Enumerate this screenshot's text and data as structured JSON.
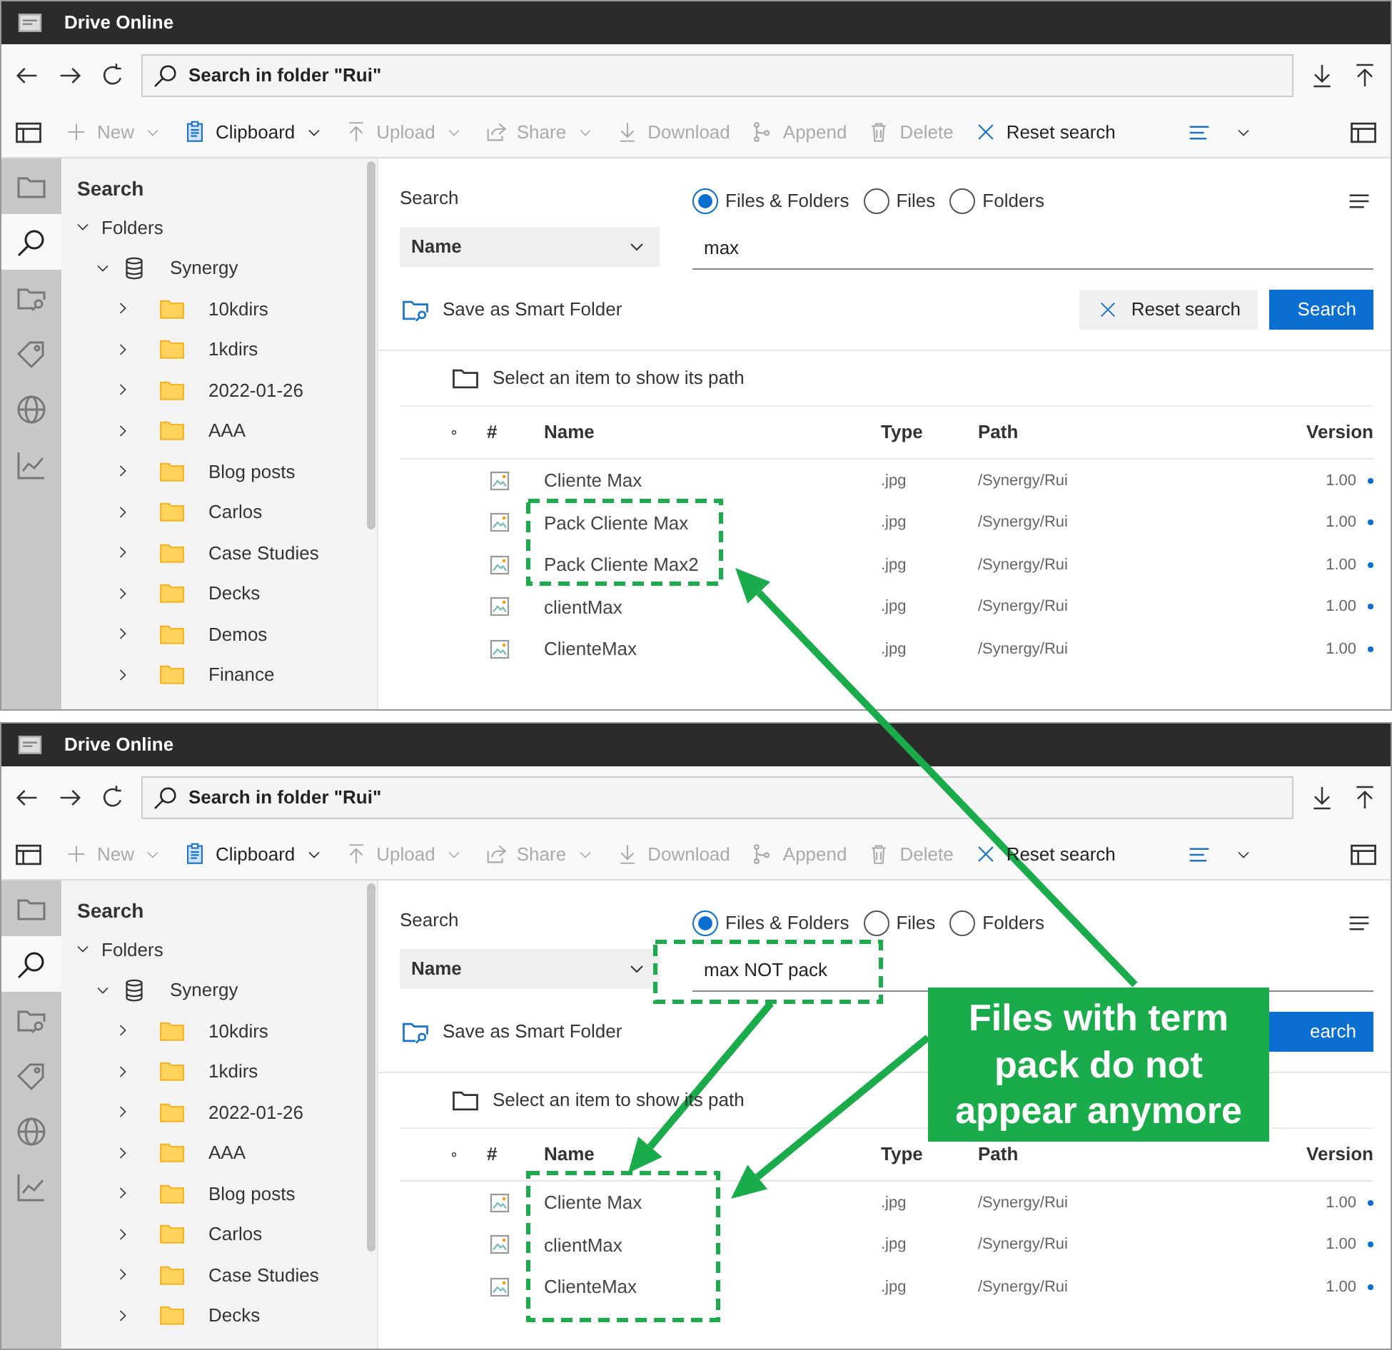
{
  "panels": [
    {
      "window": {
        "title": "Drive Online"
      },
      "address": {
        "text": "Search in folder \"Rui\""
      },
      "toolbar": [
        {
          "kind": "new",
          "label": "New",
          "disabled": true,
          "menu": true
        },
        {
          "kind": "clipboard",
          "label": "Clipboard",
          "disabled": false,
          "menu": true
        },
        {
          "kind": "upload",
          "label": "Upload",
          "disabled": true,
          "menu": true
        },
        {
          "kind": "share",
          "label": "Share",
          "disabled": true,
          "menu": true
        },
        {
          "kind": "download",
          "label": "Download",
          "disabled": true,
          "menu": false
        },
        {
          "kind": "append",
          "label": "Append",
          "disabled": true,
          "menu": false
        },
        {
          "kind": "delete",
          "label": "Delete",
          "disabled": true,
          "menu": false
        },
        {
          "kind": "reset",
          "label": "Reset search",
          "disabled": false,
          "menu": false
        }
      ],
      "rail": [
        {
          "kind": "folder",
          "selected": false
        },
        {
          "kind": "search",
          "selected": true
        },
        {
          "kind": "folder-search",
          "selected": false
        },
        {
          "kind": "tag",
          "selected": false
        },
        {
          "kind": "globe",
          "selected": false
        },
        {
          "kind": "chart",
          "selected": false
        }
      ],
      "sidebar": {
        "title": "Search",
        "tree": [
          {
            "label": "Folders",
            "kind": "group",
            "expanded": true,
            "children": [
              {
                "label": "Synergy",
                "kind": "database",
                "expanded": true,
                "children": [
                  {
                    "label": "10kdirs",
                    "kind": "folder",
                    "expanded": false
                  },
                  {
                    "label": "1kdirs",
                    "kind": "folder",
                    "expanded": false
                  },
                  {
                    "label": "2022-01-26",
                    "kind": "folder",
                    "expanded": false
                  },
                  {
                    "label": "AAA",
                    "kind": "folder",
                    "expanded": false
                  },
                  {
                    "label": "Blog posts",
                    "kind": "folder",
                    "expanded": false
                  },
                  {
                    "label": "Carlos",
                    "kind": "folder",
                    "expanded": false
                  },
                  {
                    "label": "Case Studies",
                    "kind": "folder",
                    "expanded": false
                  },
                  {
                    "label": "Decks",
                    "kind": "folder",
                    "expanded": false
                  },
                  {
                    "label": "Demos",
                    "kind": "folder",
                    "expanded": false
                  },
                  {
                    "label": "Finance",
                    "kind": "folder",
                    "expanded": false
                  }
                ]
              }
            ]
          }
        ]
      },
      "search": {
        "label": "Search",
        "scope": [
          {
            "label": "Files & Folders",
            "selected": true
          },
          {
            "label": "Files",
            "selected": false
          },
          {
            "label": "Folders",
            "selected": false
          }
        ],
        "field": "Name",
        "value": "max",
        "save_link": "Save as Smart Folder",
        "buttons": [
          {
            "kind": "reset",
            "label": "Reset search"
          },
          {
            "kind": "search",
            "label": "Search"
          }
        ]
      },
      "path_hint": "Select an item to show its path",
      "table": {
        "columns": [
          "#",
          "Name",
          "Type",
          "Path",
          "Version"
        ],
        "rows": [
          {
            "name": "Cliente Max",
            "type": ".jpg",
            "path": "/Synergy/Rui",
            "version": "1.00"
          },
          {
            "name": "Pack Cliente Max",
            "type": ".jpg",
            "path": "/Synergy/Rui",
            "version": "1.00"
          },
          {
            "name": "Pack Cliente Max2",
            "type": ".jpg",
            "path": "/Synergy/Rui",
            "version": "1.00"
          },
          {
            "name": "clientMax",
            "type": ".jpg",
            "path": "/Synergy/Rui",
            "version": "1.00"
          },
          {
            "name": "ClienteMax",
            "type": ".jpg",
            "path": "/Synergy/Rui",
            "version": "1.00"
          }
        ]
      }
    },
    {
      "window": {
        "title": "Drive Online"
      },
      "address": {
        "text": "Search in folder \"Rui\""
      },
      "toolbar": [
        {
          "kind": "new",
          "label": "New",
          "disabled": true,
          "menu": true
        },
        {
          "kind": "clipboard",
          "label": "Clipboard",
          "disabled": false,
          "menu": true
        },
        {
          "kind": "upload",
          "label": "Upload",
          "disabled": true,
          "menu": true
        },
        {
          "kind": "share",
          "label": "Share",
          "disabled": true,
          "menu": true
        },
        {
          "kind": "download",
          "label": "Download",
          "disabled": true,
          "menu": false
        },
        {
          "kind": "append",
          "label": "Append",
          "disabled": true,
          "menu": false
        },
        {
          "kind": "delete",
          "label": "Delete",
          "disabled": true,
          "menu": false
        },
        {
          "kind": "reset",
          "label": "Reset search",
          "disabled": false,
          "menu": false
        }
      ],
      "rail": [
        {
          "kind": "folder",
          "selected": false
        },
        {
          "kind": "search",
          "selected": true
        },
        {
          "kind": "folder-search",
          "selected": false
        },
        {
          "kind": "tag",
          "selected": false
        },
        {
          "kind": "globe",
          "selected": false
        },
        {
          "kind": "chart",
          "selected": false
        }
      ],
      "sidebar": {
        "title": "Search",
        "tree": [
          {
            "label": "Folders",
            "kind": "group",
            "expanded": true,
            "children": [
              {
                "label": "Synergy",
                "kind": "database",
                "expanded": true,
                "children": [
                  {
                    "label": "10kdirs",
                    "kind": "folder",
                    "expanded": false
                  },
                  {
                    "label": "1kdirs",
                    "kind": "folder",
                    "expanded": false
                  },
                  {
                    "label": "2022-01-26",
                    "kind": "folder",
                    "expanded": false
                  },
                  {
                    "label": "AAA",
                    "kind": "folder",
                    "expanded": false
                  },
                  {
                    "label": "Blog posts",
                    "kind": "folder",
                    "expanded": false
                  },
                  {
                    "label": "Carlos",
                    "kind": "folder",
                    "expanded": false
                  },
                  {
                    "label": "Case Studies",
                    "kind": "folder",
                    "expanded": false
                  },
                  {
                    "label": "Decks",
                    "kind": "folder",
                    "expanded": false
                  }
                ]
              }
            ]
          }
        ]
      },
      "search": {
        "label": "Search",
        "scope": [
          {
            "label": "Files & Folders",
            "selected": true
          },
          {
            "label": "Files",
            "selected": false
          },
          {
            "label": "Folders",
            "selected": false
          }
        ],
        "field": "Name",
        "value": "max NOT pack",
        "save_link": "Save as Smart Folder",
        "buttons": [
          {
            "kind": "search",
            "label": "earch"
          }
        ]
      },
      "path_hint": "Select an item to show its path",
      "table": {
        "columns": [
          "#",
          "Name",
          "Type",
          "Path",
          "Version"
        ],
        "rows": [
          {
            "name": "Cliente Max",
            "type": ".jpg",
            "path": "/Synergy/Rui",
            "version": "1.00"
          },
          {
            "name": "clientMax",
            "type": ".jpg",
            "path": "/Synergy/Rui",
            "version": "1.00"
          },
          {
            "name": "ClienteMax",
            "type": ".jpg",
            "path": "/Synergy/Rui",
            "version": "1.00"
          }
        ]
      }
    }
  ],
  "annotation": {
    "callout": "Files with term pack do not appear anymore"
  }
}
